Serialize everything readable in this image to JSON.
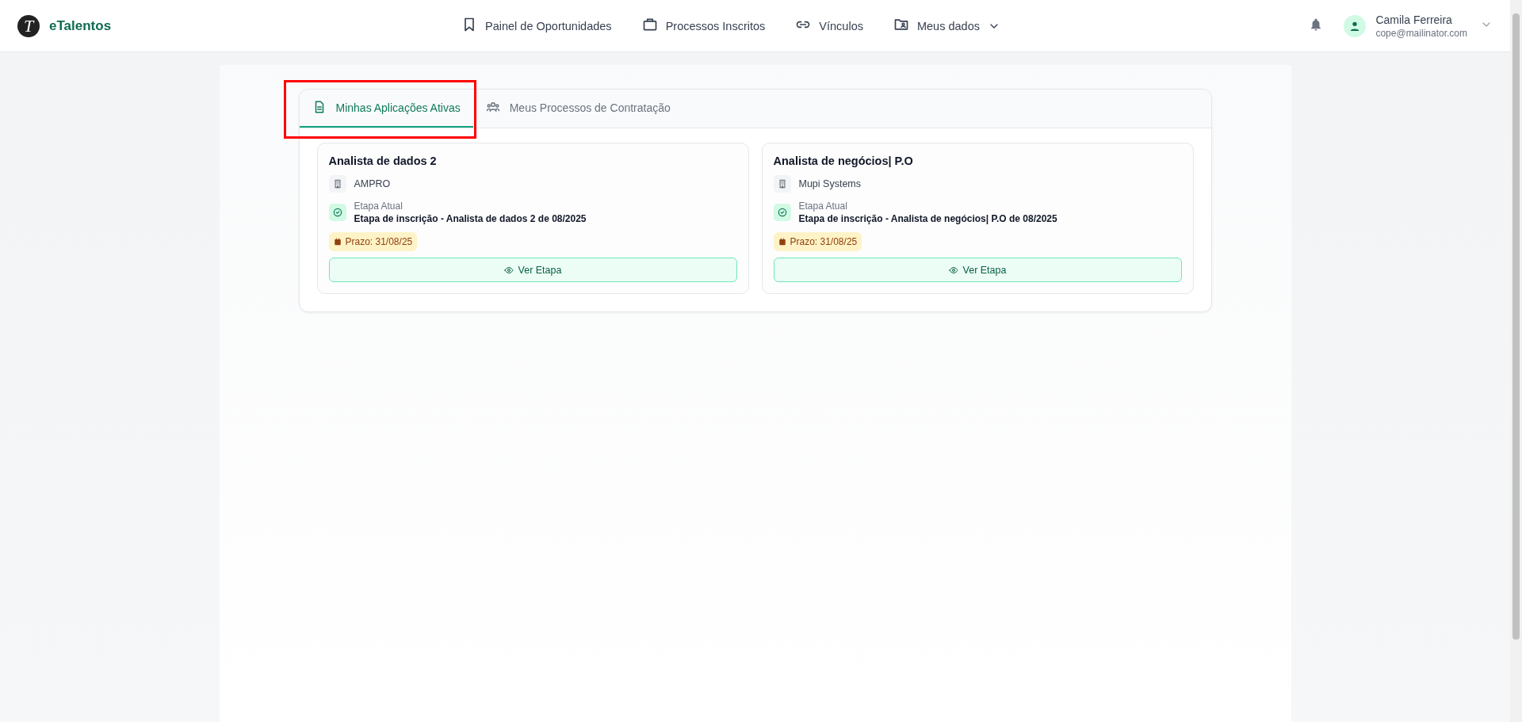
{
  "brand": {
    "logo_letter": "T",
    "name": "eTalentos"
  },
  "nav": [
    {
      "label": "Painel de Oportunidades",
      "kind": "bookmark",
      "dropdown": false
    },
    {
      "label": "Processos Inscritos",
      "kind": "briefcase",
      "dropdown": false
    },
    {
      "label": "Vínculos",
      "kind": "link",
      "dropdown": false
    },
    {
      "label": "Meus dados",
      "kind": "folder",
      "dropdown": true
    }
  ],
  "user": {
    "name": "Camila Ferreira",
    "email": "cope@mailinator.com"
  },
  "tabs": [
    {
      "label": "Minhas Aplicações Ativas",
      "kind": "document",
      "selected": true,
      "highlighted": true
    },
    {
      "label": "Meus Processos de Contratação",
      "kind": "people",
      "selected": false,
      "highlighted": false
    }
  ],
  "applications": [
    {
      "title": "Analista de dados 2",
      "company": "AMPRO",
      "stage_label": "Etapa Atual",
      "stage": "Etapa de inscrição - Analista de dados 2 de 08/2025",
      "deadline": "Prazo: 31/08/25",
      "action": "Ver Etapa"
    },
    {
      "title": "Analista de negócios| P.O",
      "company": "Mupi Systems",
      "stage_label": "Etapa Atual",
      "stage": "Etapa de inscrição - Analista de negócios| P.O de 08/2025",
      "deadline": "Prazo: 31/08/25",
      "action": "Ver Etapa"
    }
  ]
}
